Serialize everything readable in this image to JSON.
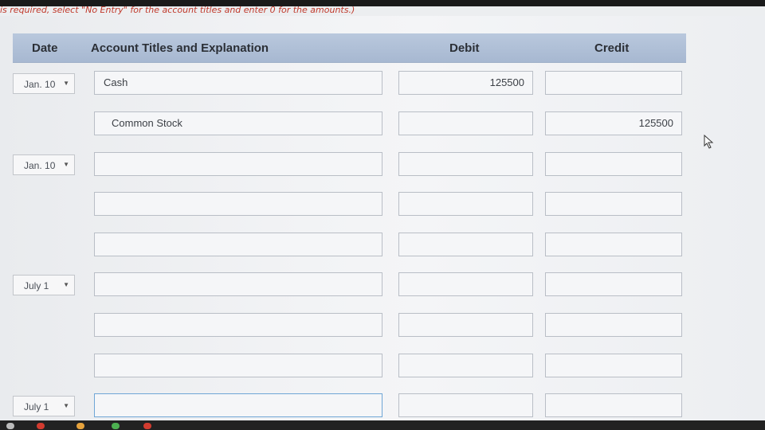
{
  "instruction": "is required, select \"No Entry\" for the account titles and enter 0 for the amounts.)",
  "table": {
    "headers": {
      "date": "Date",
      "account": "Account Titles and Explanation",
      "debit": "Debit",
      "credit": "Credit"
    },
    "rows": [
      {
        "date": "Jan. 10",
        "account": "Cash",
        "debit": "125500",
        "credit": ""
      },
      {
        "date": "",
        "account": "Common Stock",
        "debit": "",
        "credit": "125500"
      },
      {
        "date": "Jan. 10",
        "account": "",
        "debit": "",
        "credit": ""
      },
      {
        "date": "",
        "account": "",
        "debit": "",
        "credit": ""
      },
      {
        "date": "",
        "account": "",
        "debit": "",
        "credit": ""
      },
      {
        "date": "July 1",
        "account": "",
        "debit": "",
        "credit": ""
      },
      {
        "date": "",
        "account": "",
        "debit": "",
        "credit": ""
      },
      {
        "date": "",
        "account": "",
        "debit": "",
        "credit": ""
      },
      {
        "date": "July 1",
        "account": "",
        "debit": "",
        "credit": ""
      }
    ]
  },
  "dropdown_icon": "triangle-down-icon",
  "colors": {
    "header_bg": "#b3c3da",
    "instruction_text": "#c0392b",
    "focus_border": "#6fa6d6"
  }
}
